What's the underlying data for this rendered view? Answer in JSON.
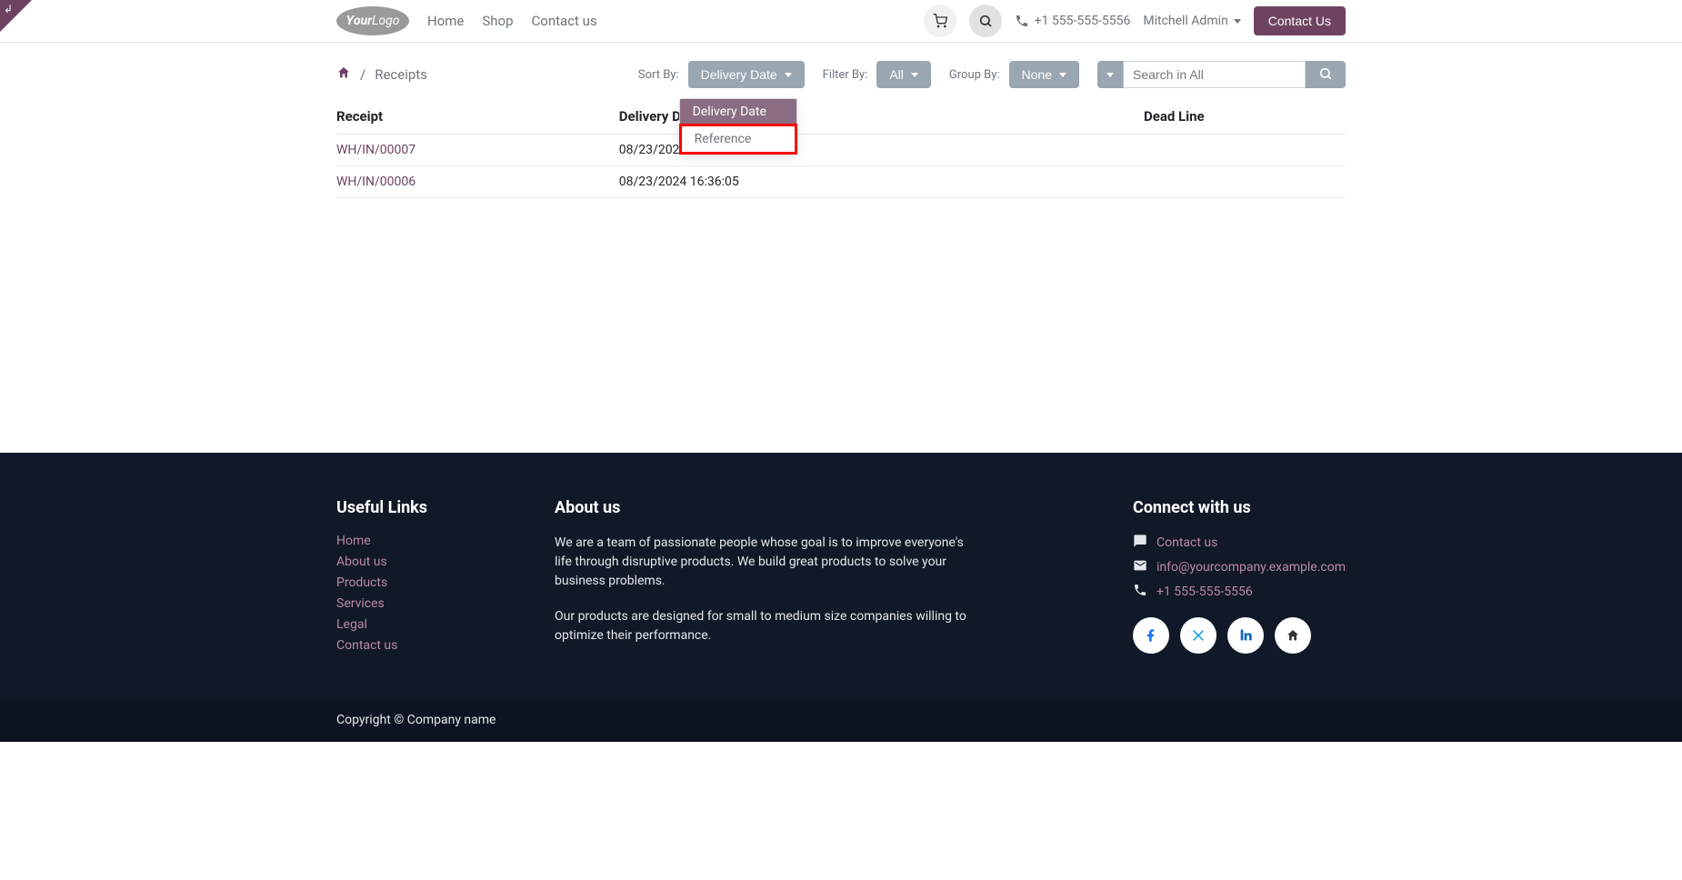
{
  "nav": {
    "logo_text": "YourLogo",
    "links": [
      "Home",
      "Shop",
      "Contact us"
    ],
    "phone": "+1 555-555-5556",
    "user": "Mitchell Admin",
    "contact_btn": "Contact Us"
  },
  "breadcrumb": {
    "current": "Receipts"
  },
  "controls": {
    "sort_label": "Sort By:",
    "sort_value": "Delivery Date",
    "sort_options": [
      "Delivery Date",
      "Reference"
    ],
    "filter_label": "Filter By:",
    "filter_value": "All",
    "group_label": "Group By:",
    "group_value": "None",
    "search_placeholder": "Search in All"
  },
  "table": {
    "headers": [
      "Receipt",
      "Delivery Date",
      "Dead Line"
    ],
    "rows": [
      {
        "receipt": "WH/IN/00007",
        "date": "08/23/2024 16:36:26",
        "deadline": ""
      },
      {
        "receipt": "WH/IN/00006",
        "date": "08/23/2024 16:36:05",
        "deadline": ""
      }
    ]
  },
  "footer": {
    "useful_title": "Useful Links",
    "useful_links": [
      "Home",
      "About us",
      "Products",
      "Services",
      "Legal",
      "Contact us"
    ],
    "about_title": "About us",
    "about_p1": "We are a team of passionate people whose goal is to improve everyone's life through disruptive products. We build great products to solve your business problems.",
    "about_p2": "Our products are designed for small to medium size companies willing to optimize their performance.",
    "connect_title": "Connect with us",
    "connect_items": {
      "contact": "Contact us",
      "email": "info@yourcompany.example.com",
      "phone": "+1 555-555-5556"
    },
    "copyright": "Copyright © Company name"
  }
}
